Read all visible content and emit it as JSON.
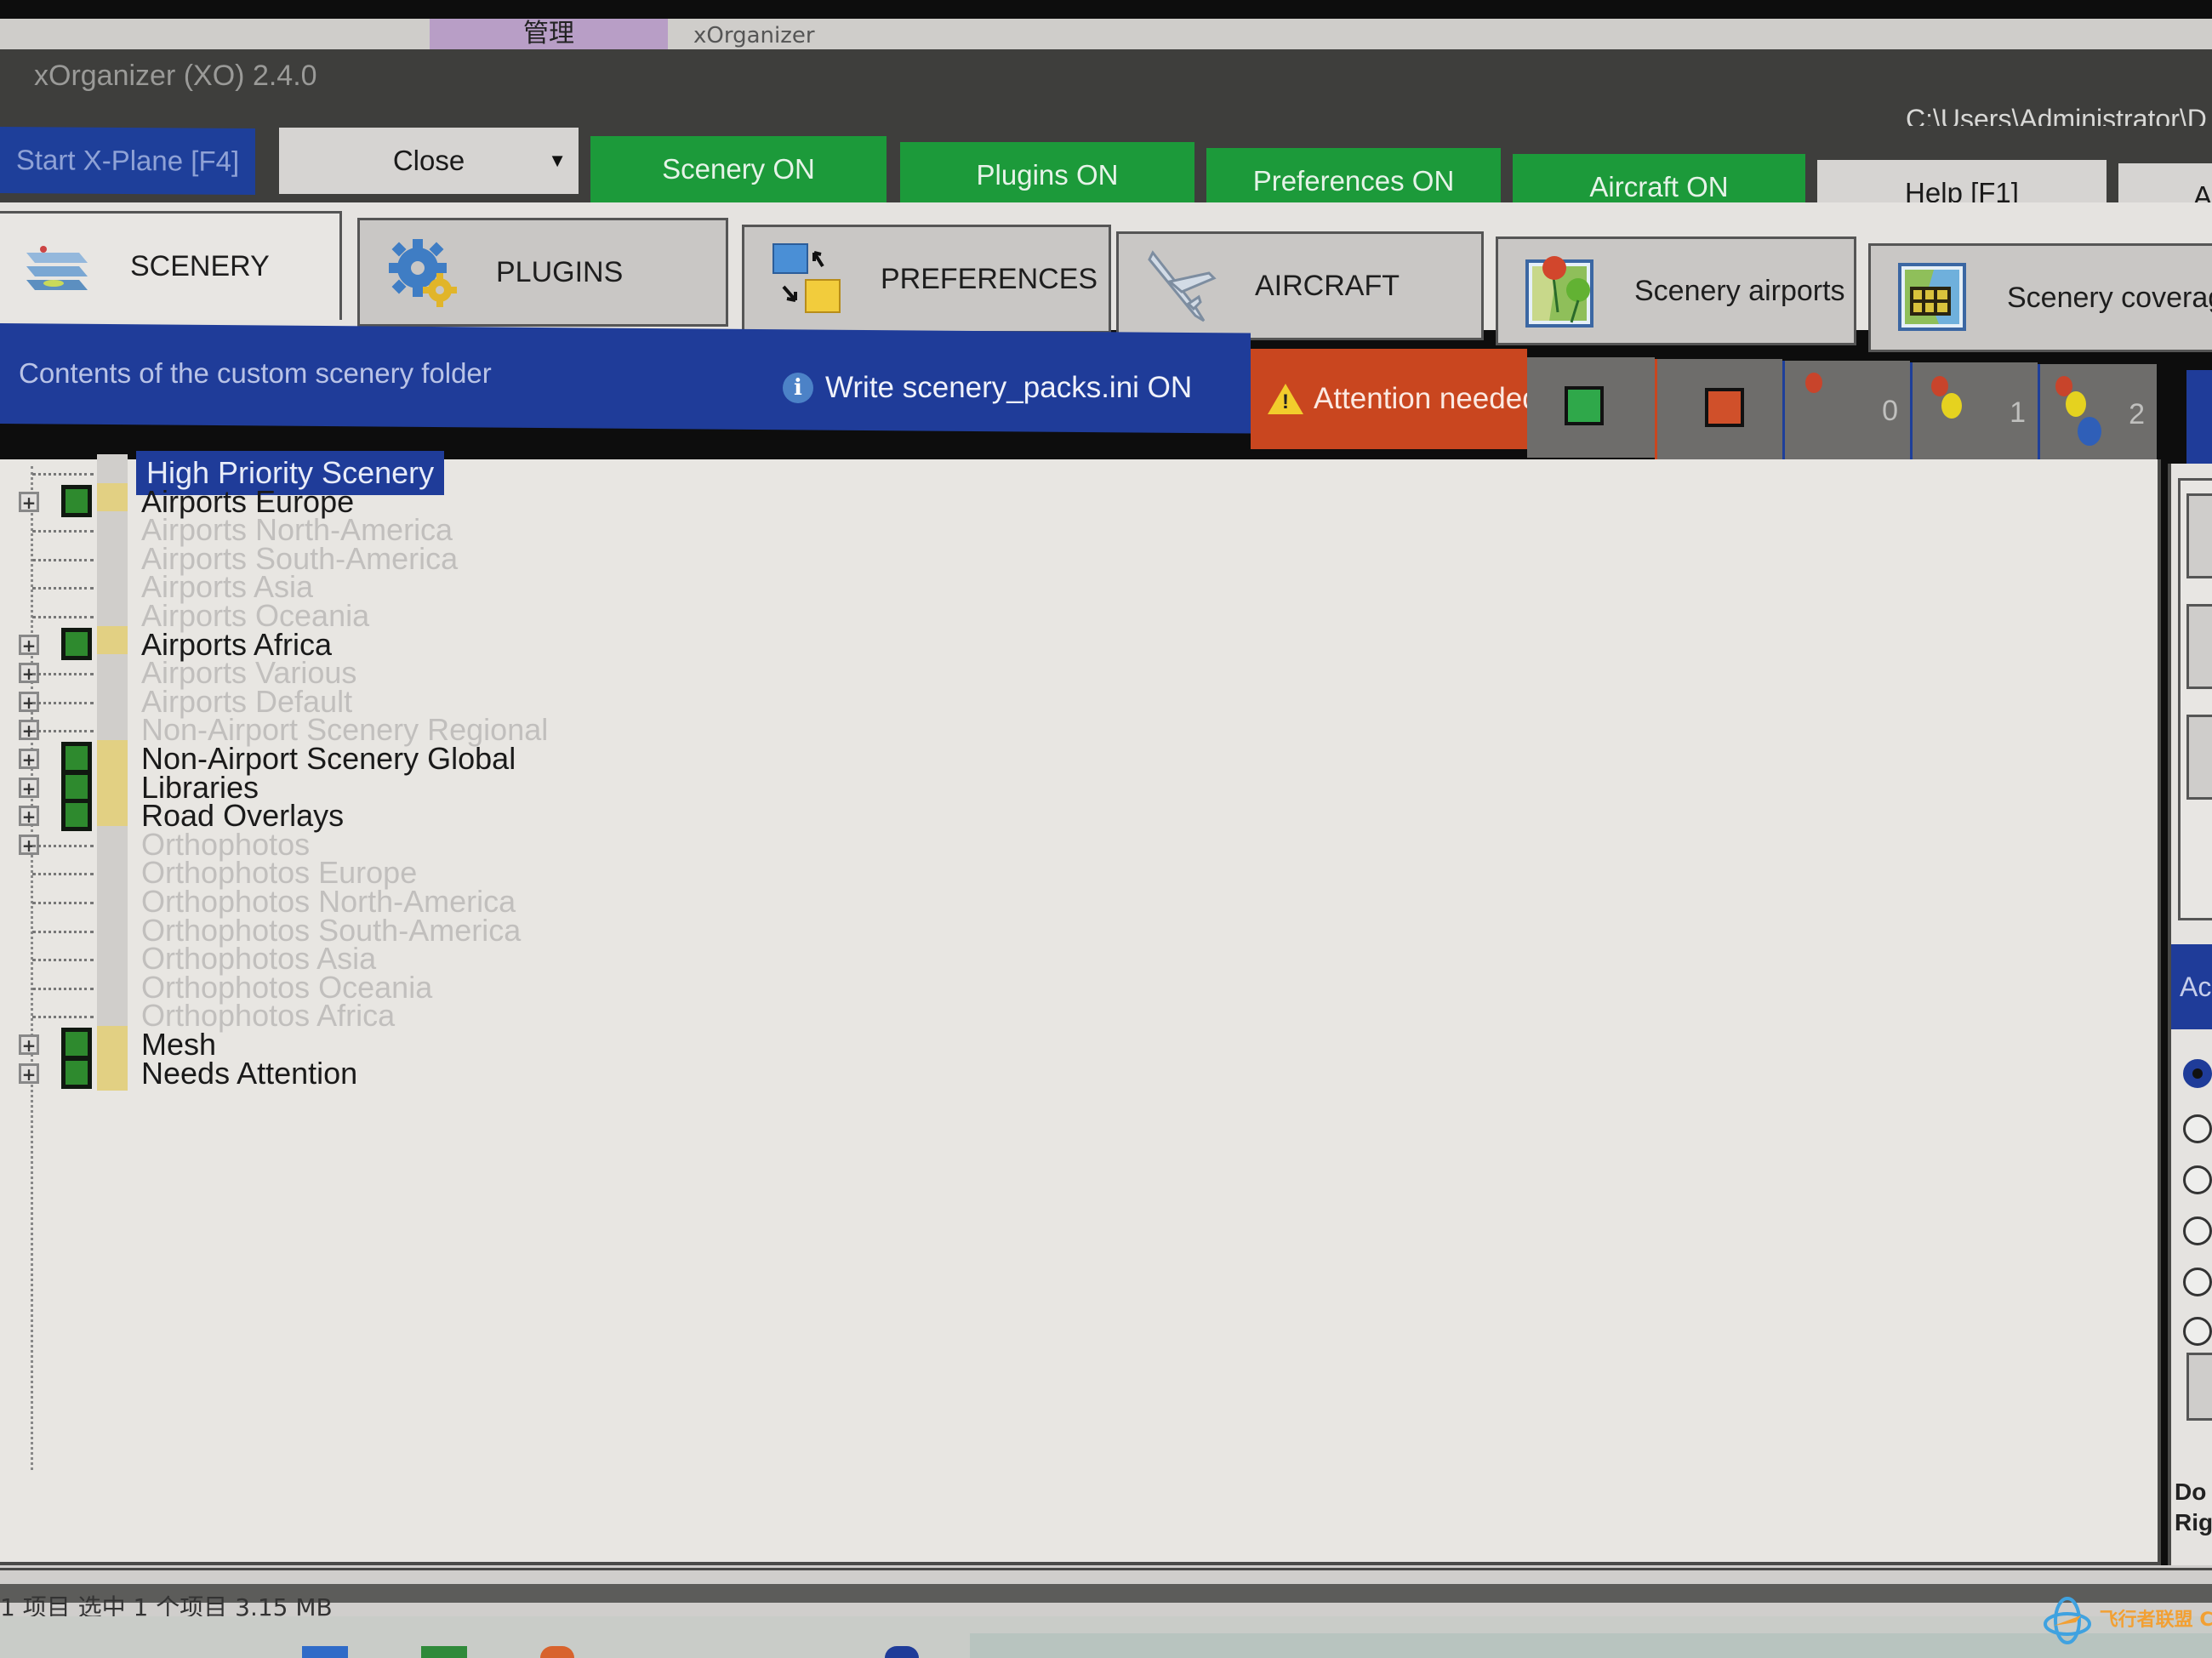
{
  "explorer": {
    "tab_manage": "管理",
    "tab_app": "xOrganizer"
  },
  "window": {
    "title": "xOrganizer (XO) 2.4.0",
    "path": "C:\\Users\\Administrator\\D"
  },
  "toolbar": {
    "start_label": "Start X-Plane [F4]",
    "close_label": "Close",
    "scenery_label": "Scenery ON",
    "plugins_label": "Plugins ON",
    "preferences_label": "Preferences ON",
    "aircraft_label": "Aircraft ON",
    "help_label": "Help [F1]",
    "extra_label": "A"
  },
  "tabs": [
    {
      "label": "SCENERY",
      "icon": "scenery-layers-icon",
      "active": true
    },
    {
      "label": "PLUGINS",
      "icon": "gears-icon",
      "active": false
    },
    {
      "label": "PREFERENCES",
      "icon": "swap-squares-icon",
      "active": false
    },
    {
      "label": "AIRCRAFT",
      "icon": "airplane-icon",
      "active": false
    },
    {
      "label": "Scenery airports",
      "icon": "map-pins-icon",
      "active": false
    },
    {
      "label": "Scenery coverage",
      "icon": "map-grid-icon",
      "active": false
    }
  ],
  "infobar": {
    "contents_label": "Contents of the custom scenery folder",
    "write_label": "Write scenery_packs.ini ON",
    "attention_label": "Attention needed",
    "counts": [
      "0",
      "1",
      "2"
    ]
  },
  "colors": {
    "accent_blue": "#1f3c99",
    "on_green": "#1c9a3a",
    "attention_red": "#c9461f"
  },
  "tree": [
    {
      "label": "High Priority Scenery",
      "enabled": false,
      "expandable": false,
      "selected": true
    },
    {
      "label": "Airports Europe",
      "enabled": true,
      "expandable": true,
      "selected": false
    },
    {
      "label": "Airports North-America",
      "enabled": false,
      "expandable": false,
      "selected": false
    },
    {
      "label": "Airports South-America",
      "enabled": false,
      "expandable": false,
      "selected": false
    },
    {
      "label": "Airports Asia",
      "enabled": false,
      "expandable": false,
      "selected": false
    },
    {
      "label": "Airports Oceania",
      "enabled": false,
      "expandable": false,
      "selected": false
    },
    {
      "label": "Airports Africa",
      "enabled": true,
      "expandable": true,
      "selected": false
    },
    {
      "label": "Airports Various",
      "enabled": false,
      "expandable": true,
      "selected": false
    },
    {
      "label": "Airports Default",
      "enabled": false,
      "expandable": true,
      "selected": false
    },
    {
      "label": "Non-Airport Scenery Regional",
      "enabled": false,
      "expandable": true,
      "selected": false
    },
    {
      "label": "Non-Airport Scenery Global",
      "enabled": true,
      "expandable": true,
      "selected": false
    },
    {
      "label": "Libraries",
      "enabled": true,
      "expandable": true,
      "selected": false
    },
    {
      "label": "Road Overlays",
      "enabled": true,
      "expandable": true,
      "selected": false
    },
    {
      "label": "Orthophotos",
      "enabled": false,
      "expandable": true,
      "selected": false
    },
    {
      "label": "Orthophotos Europe",
      "enabled": false,
      "expandable": false,
      "selected": false
    },
    {
      "label": "Orthophotos North-America",
      "enabled": false,
      "expandable": false,
      "selected": false
    },
    {
      "label": "Orthophotos South-America",
      "enabled": false,
      "expandable": false,
      "selected": false
    },
    {
      "label": "Orthophotos Asia",
      "enabled": false,
      "expandable": false,
      "selected": false
    },
    {
      "label": "Orthophotos Oceania",
      "enabled": false,
      "expandable": false,
      "selected": false
    },
    {
      "label": "Orthophotos Africa",
      "enabled": false,
      "expandable": false,
      "selected": false
    },
    {
      "label": "Mesh",
      "enabled": true,
      "expandable": true,
      "selected": false
    },
    {
      "label": "Needs Attention",
      "enabled": true,
      "expandable": true,
      "selected": false
    }
  ],
  "right_panel": {
    "header": "Ac",
    "footer_line1": "Do",
    "footer_line2": "Rig"
  },
  "statusbar": {
    "text": "1 项目    选中 1 个项目 3.15 MB"
  },
  "watermark": {
    "text": "飞行者联盟 China Flier"
  }
}
